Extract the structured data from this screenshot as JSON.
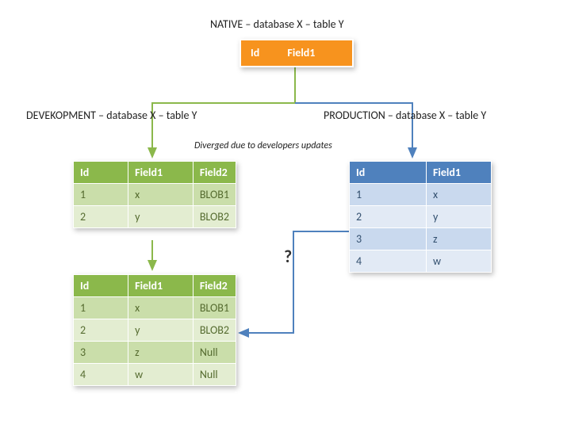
{
  "title_native": "NATIVE – database X – table Y",
  "title_dev": "DEVEKOPMENT – database X – table Y",
  "title_prod": "PRODUCTION – database X – table Y",
  "caption_diverged": "Diverged due to developers updates",
  "native": {
    "cols": [
      "Id",
      "Field1"
    ]
  },
  "dev_table": {
    "cols": [
      "Id",
      "Field1",
      "Field2"
    ],
    "rows": [
      {
        "c0": "1",
        "c1": "x",
        "c2": "BLOB1"
      },
      {
        "c0": "2",
        "c1": "y",
        "c2": "BLOB2"
      }
    ]
  },
  "prod_table": {
    "cols": [
      "Id",
      "Field1"
    ],
    "rows": [
      {
        "c0": "1",
        "c1": "x"
      },
      {
        "c0": "2",
        "c1": "y"
      },
      {
        "c0": "3",
        "c1": "z"
      },
      {
        "c0": "4",
        "c1": "w"
      }
    ]
  },
  "merged_table": {
    "cols": [
      "Id",
      "Field1",
      "Field2"
    ],
    "rows": [
      {
        "c0": "1",
        "c1": "x",
        "c2": "BLOB1"
      },
      {
        "c0": "2",
        "c1": "y",
        "c2": "BLOB2"
      },
      {
        "c0": "3",
        "c1": "z",
        "c2": "Null"
      },
      {
        "c0": "4",
        "c1": "w",
        "c2": "Null"
      }
    ]
  },
  "question_mark": "?"
}
